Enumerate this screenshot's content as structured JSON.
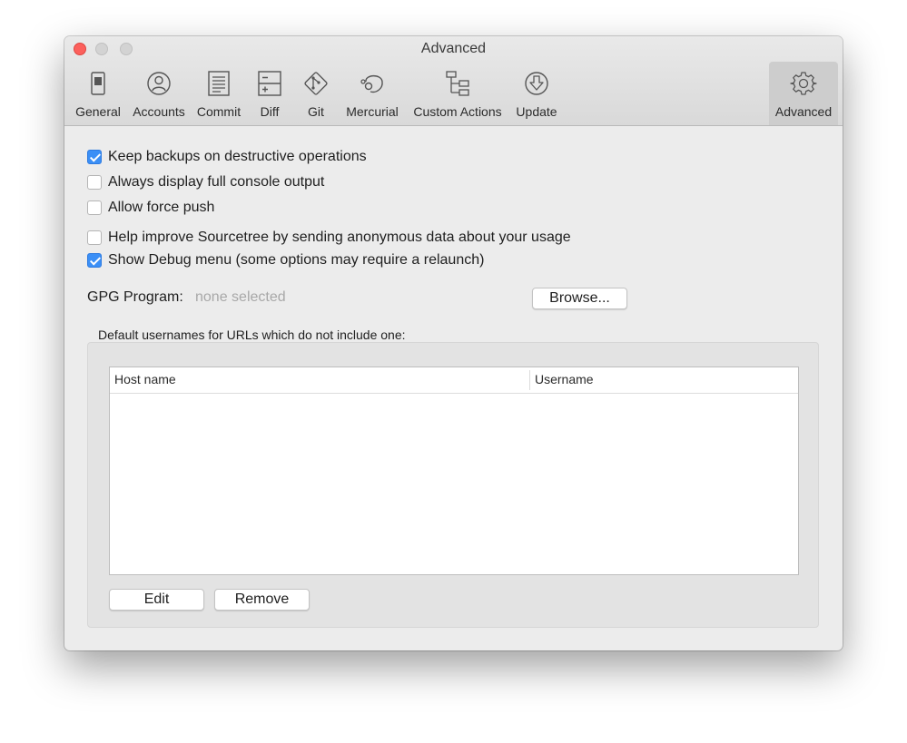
{
  "window": {
    "title": "Advanced"
  },
  "toolbar": {
    "items": [
      {
        "label": "General",
        "icon": "switch-icon"
      },
      {
        "label": "Accounts",
        "icon": "user-icon"
      },
      {
        "label": "Commit",
        "icon": "document-lines-icon"
      },
      {
        "label": "Diff",
        "icon": "diff-icon"
      },
      {
        "label": "Git",
        "icon": "git-icon"
      },
      {
        "label": "Mercurial",
        "icon": "mercurial-icon"
      },
      {
        "label": "Custom Actions",
        "icon": "hierarchy-icon"
      },
      {
        "label": "Update",
        "icon": "download-icon"
      },
      {
        "label": "Advanced",
        "icon": "gear-icon",
        "selected": true
      }
    ]
  },
  "options": {
    "backups": {
      "label": "Keep backups on destructive operations",
      "checked": true
    },
    "console": {
      "label": "Always display full console output",
      "checked": false
    },
    "force_push": {
      "label": "Allow force push",
      "checked": false
    },
    "analytics": {
      "label": "Help improve Sourcetree by sending anonymous data about your usage",
      "checked": false
    },
    "debug_menu": {
      "label": "Show Debug menu (some options may require a relaunch)",
      "checked": true
    }
  },
  "gpg": {
    "label": "GPG Program:",
    "value": "none selected",
    "browse_label": "Browse..."
  },
  "usernames": {
    "caption": "Default usernames for URLs which do not include one:",
    "columns": [
      "Host name",
      "Username"
    ],
    "rows": [],
    "edit_label": "Edit",
    "remove_label": "Remove"
  },
  "colors": {
    "accent": "#3b8ff6",
    "close": "#fc605c"
  }
}
